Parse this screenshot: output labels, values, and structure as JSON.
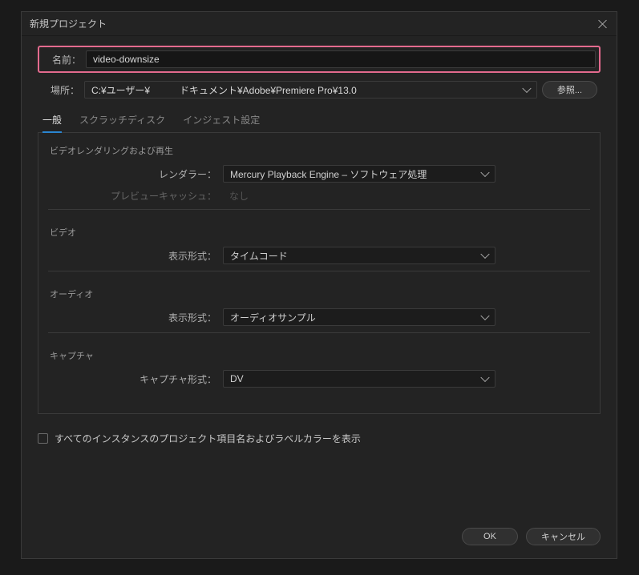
{
  "dialog": {
    "title": "新規プロジェクト",
    "name_label": "名前：",
    "name_value": "video-downsize",
    "location_label": "場所：",
    "location_path1": "C:¥ユーザー¥",
    "location_path2": "ドキュメント¥Adobe¥Premiere Pro¥13.0",
    "browse_label": "参照..."
  },
  "tabs": {
    "general": "一般",
    "scratch": "スクラッチディスク",
    "ingest": "インジェスト設定"
  },
  "sections": {
    "rendering": {
      "title": "ビデオレンダリングおよび再生",
      "renderer_label": "レンダラー：",
      "renderer_value": "Mercury Playback Engine – ソフトウェア処理",
      "preview_cache_label": "プレビューキャッシュ：",
      "preview_cache_value": "なし"
    },
    "video": {
      "title": "ビデオ",
      "format_label": "表示形式：",
      "format_value": "タイムコード"
    },
    "audio": {
      "title": "オーディオ",
      "format_label": "表示形式：",
      "format_value": "オーディオサンプル"
    },
    "capture": {
      "title": "キャプチャ",
      "format_label": "キャプチャ形式：",
      "format_value": "DV"
    }
  },
  "checkbox_label": "すべてのインスタンスのプロジェクト項目名およびラベルカラーを表示",
  "footer": {
    "ok": "OK",
    "cancel": "キャンセル"
  }
}
